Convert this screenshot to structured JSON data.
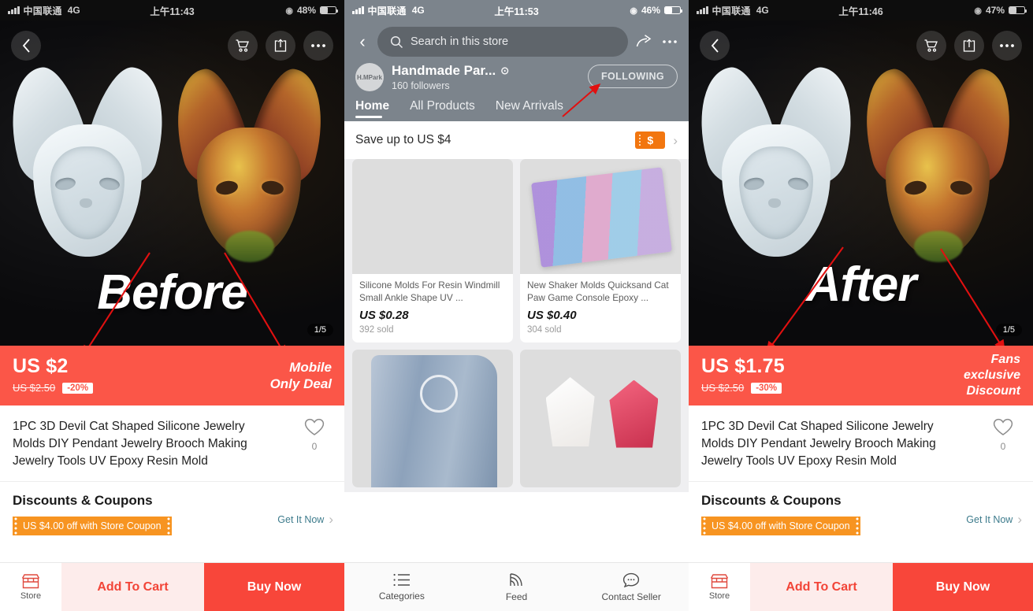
{
  "panels": {
    "left": {
      "status": {
        "carrier": "中国联通",
        "network": "4G",
        "time": "上午11:43",
        "battery": "48%"
      },
      "hero": {
        "overlay_word": "Before",
        "counter": "1/5"
      },
      "nav": {
        "back": "back-chevron",
        "cart": "cart-icon",
        "share": "share-icon",
        "more": "more-icon"
      },
      "price": {
        "current": "US $2",
        "original": "US $2.50",
        "discount": "-20%",
        "tag_line1": "Mobile",
        "tag_line2": "Only Deal"
      },
      "product": {
        "title": "1PC 3D Devil Cat Shaped Silicone Jewelry Molds DIY Pendant Jewelry Brooch Making Jewelry Tools UV Epoxy Resin Mold",
        "wish_count": "0"
      },
      "discounts": {
        "heading": "Discounts & Coupons",
        "coupon": "US $4.00 off with Store Coupon",
        "get_it_now": "Get It Now"
      },
      "actions": {
        "store": "Store",
        "add_to_cart": "Add To Cart",
        "buy_now": "Buy Now"
      }
    },
    "middle": {
      "status": {
        "carrier": "中国联通",
        "network": "4G",
        "time": "上午11:53",
        "battery": "46%"
      },
      "search": {
        "placeholder": "Search in this store"
      },
      "store": {
        "avatar_text": "H.MPark",
        "name": "Handmade Par...",
        "followers": "160  followers",
        "follow_button": "FOLLOWING"
      },
      "tabs": [
        {
          "label": "Home",
          "active": true
        },
        {
          "label": "All Products",
          "active": false
        },
        {
          "label": "New Arrivals",
          "active": false
        }
      ],
      "promo": {
        "text": "Save up to US $4"
      },
      "products": [
        {
          "title": "Silicone Molds For Resin Windmill Small Ankle Shape UV ...",
          "price": "US $0.28",
          "sold": "392 sold"
        },
        {
          "title": "New Shaker Molds Quicksand Cat Paw Game Console Epoxy ...",
          "price": "US $0.40",
          "sold": "304 sold"
        }
      ],
      "bottom_nav": [
        {
          "label": "Categories",
          "icon": "list-icon"
        },
        {
          "label": "Feed",
          "icon": "feed-icon"
        },
        {
          "label": "Contact Seller",
          "icon": "chat-icon"
        }
      ]
    },
    "right": {
      "status": {
        "carrier": "中国联通",
        "network": "4G",
        "time": "上午11:46",
        "battery": "47%"
      },
      "hero": {
        "overlay_word": "After",
        "counter": "1/5"
      },
      "price": {
        "current": "US $1.75",
        "original": "US $2.50",
        "discount": "-30%",
        "tag_line1": "Fans",
        "tag_line2": "exclusive",
        "tag_line3": "Discount"
      },
      "product": {
        "title": "1PC 3D Devil Cat Shaped Silicone Jewelry Molds DIY Pendant Jewelry Brooch Making Jewelry Tools UV Epoxy Resin Mold",
        "wish_count": "0"
      },
      "discounts": {
        "heading": "Discounts & Coupons",
        "coupon": "US $4.00 off with Store Coupon",
        "get_it_now": "Get It Now"
      },
      "actions": {
        "store": "Store",
        "add_to_cart": "Add To Cart",
        "buy_now": "Buy Now"
      }
    }
  },
  "colors": {
    "price_red": "#fb5648",
    "buy_red": "#f8463a",
    "coupon_orange": "#f79421",
    "store_gray": "#7c848c",
    "annotation_red": "#e11010",
    "link_teal": "#3d7b8c"
  }
}
